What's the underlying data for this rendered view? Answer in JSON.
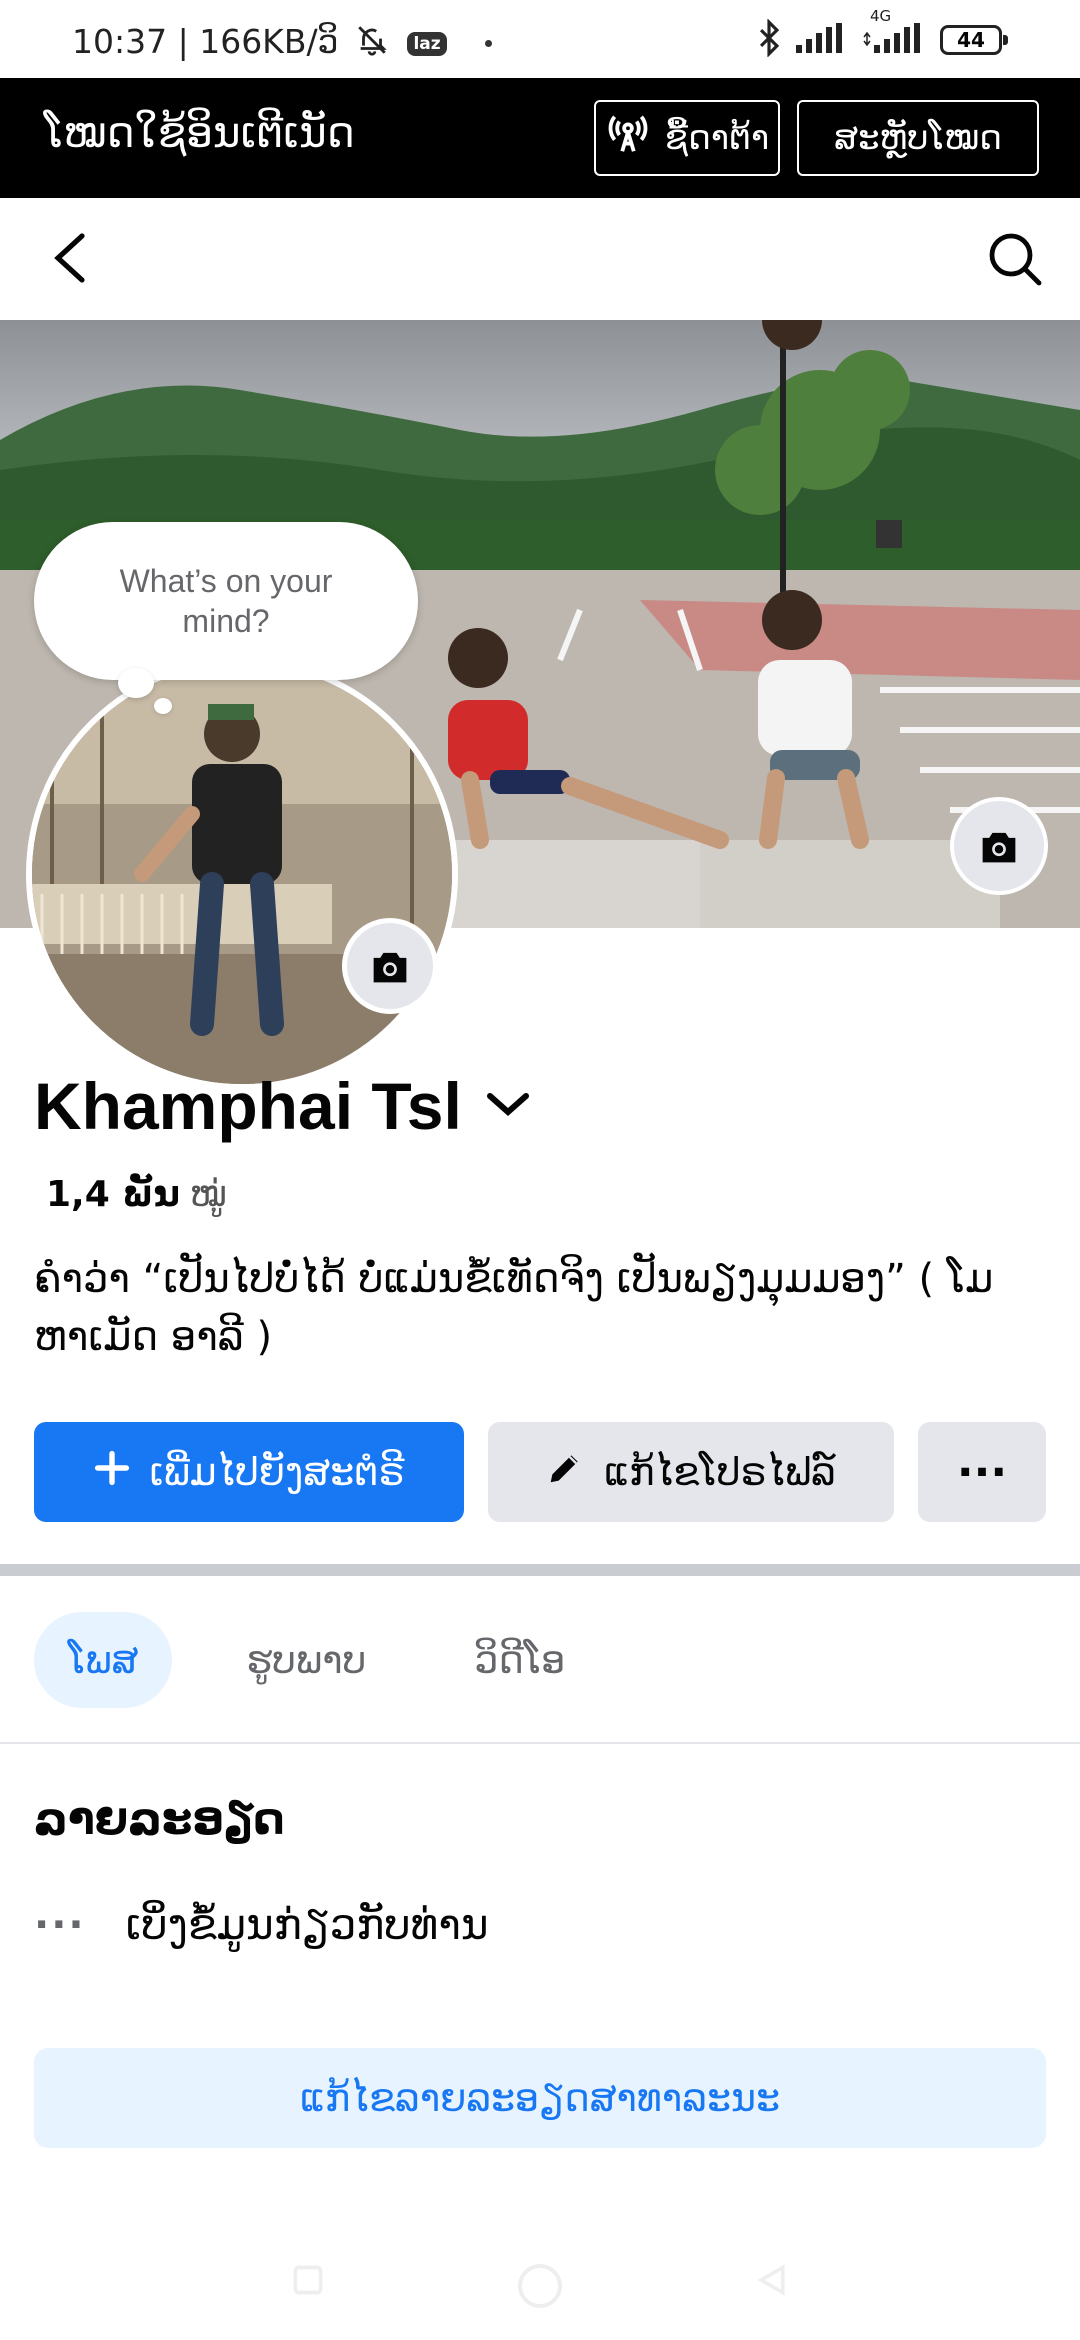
{
  "status_bar": {
    "time_network": "10:37 | 166KB/ວິ",
    "network_type": "4G",
    "battery": "44",
    "app_badge": "laz"
  },
  "mode_bar": {
    "title": "ໂໝດໃຊ້ອິນເຕີເນັດ",
    "data_button": "ຊື້ດາຕ້າ",
    "switch_button": "ສະຫຼັບໂໝດ"
  },
  "composer": {
    "thought_bubble": "What’s on your mind?"
  },
  "profile": {
    "name": "Khamphai Tsl",
    "friends_count": "1,4 ພັນ",
    "friends_label": "ໝູ່",
    "bio": "ຄຳວ່າ “ເປັນໄປບໍ່ໄດ້ ບໍ່ແມ່ນຂໍ້ເທັດຈິງ ເປັນພຽງມຸມມອງ” ( ໂມຫາເມັດ ອາລີ )"
  },
  "actions": {
    "add_to_story": "ເພີ່ມໄປຍັງສະຕໍຣີ",
    "edit_profile": "ແກ້ໄຂໂປຣໄຟລ໌",
    "more": "···"
  },
  "tabs": [
    {
      "label": "ໂພສ",
      "active": true
    },
    {
      "label": "ຮູບພາບ",
      "active": false
    },
    {
      "label": "ວິດີໂອ",
      "active": false
    }
  ],
  "details": {
    "heading": "ລາຍລະອຽດ",
    "more_dots": "···",
    "see_info": "ເບິ່ງຂໍ້ມູນກ່ຽວກັບທ່ານ",
    "edit_public_details": "ແກ້ໄຂລາຍລະອຽດສາທາລະນະ"
  },
  "colors": {
    "accent": "#1877f2",
    "secondary_button": "#e4e6eb",
    "active_tab_bg": "#e7f3ff",
    "mode_bar": "#000000"
  },
  "icons": [
    "back-icon",
    "search-icon",
    "camera-icon",
    "plus-icon",
    "pencil-icon",
    "antenna-icon",
    "bluetooth-icon",
    "signal-icon",
    "mute-bell-icon"
  ]
}
